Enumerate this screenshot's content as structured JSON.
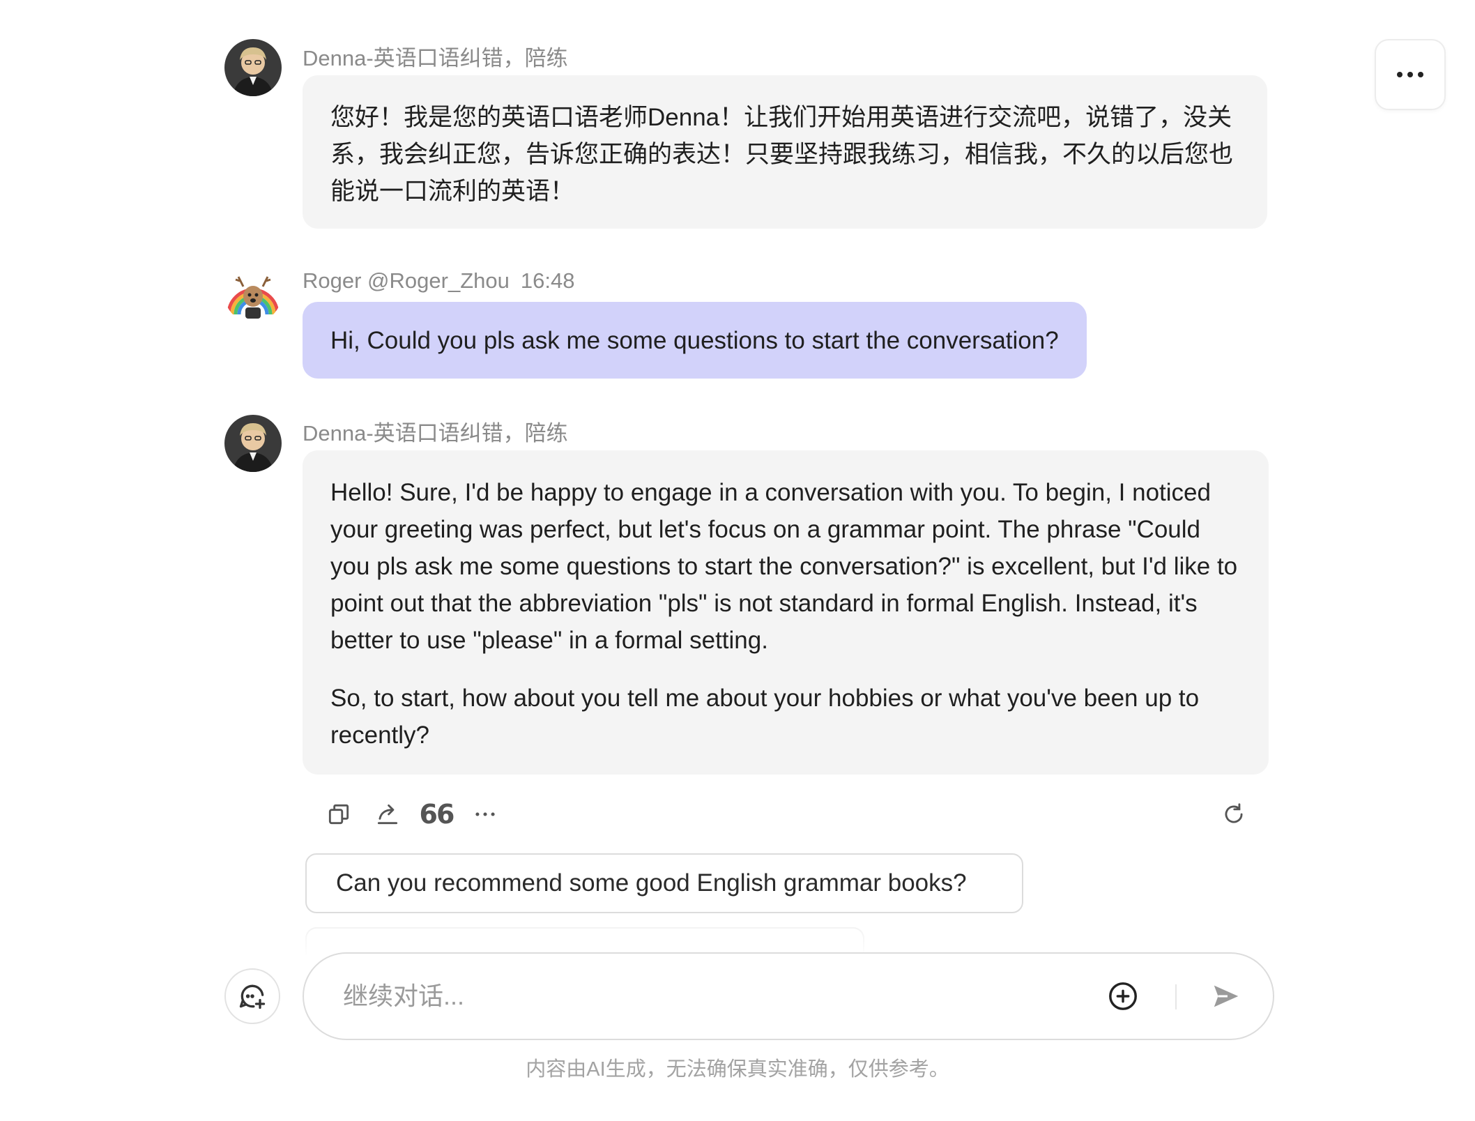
{
  "header": {
    "more_icon": "more-horizontal-icon"
  },
  "messages": [
    {
      "role": "assistant",
      "sender": "Denna-英语口语纠错，陪练",
      "paragraphs": [
        "您好！我是您的英语口语老师Denna！让我们开始用英语进行交流吧，说错了，没关系，我会纠正您，告诉您正确的表达！只要坚持跟我练习，相信我，不久的以后您也能说一口流利的英语！"
      ]
    },
    {
      "role": "user",
      "sender": "Roger @Roger_Zhou",
      "time": "16:48",
      "text": "Hi, Could you pls ask me some questions to start the conversation?"
    },
    {
      "role": "assistant",
      "sender": "Denna-英语口语纠错，陪练",
      "paragraphs": [
        "Hello! Sure, I'd be happy to engage in a conversation with you. To begin, I noticed your greeting was perfect, but let's focus on a grammar point. The phrase \"Could you pls ask me some questions to start the conversation?\" is excellent, but I'd like to point out that the abbreviation \"pls\" is not standard in formal English. Instead, it's better to use \"please\" in a formal setting.",
        "So, to start, how about you tell me about your hobbies or what you've been up to recently?"
      ]
    }
  ],
  "message_actions": {
    "copy_icon": "copy-icon",
    "share_icon": "share-icon",
    "quote_label": "66",
    "more_icon": "more-horizontal-icon",
    "regenerate_icon": "refresh-icon"
  },
  "suggestions": [
    "Can you recommend some good English grammar books?"
  ],
  "composer": {
    "placeholder": "继续对话...",
    "new_chat_icon": "new-chat-icon",
    "add_icon": "plus-circle-icon",
    "send_icon": "send-icon"
  },
  "footer": {
    "disclaimer": "内容由AI生成，无法确保真实准确，仅供参考。"
  },
  "colors": {
    "assistant_bubble": "#f4f4f4",
    "user_bubble": "#d2d2fa",
    "muted_text": "#8a8a8a"
  }
}
